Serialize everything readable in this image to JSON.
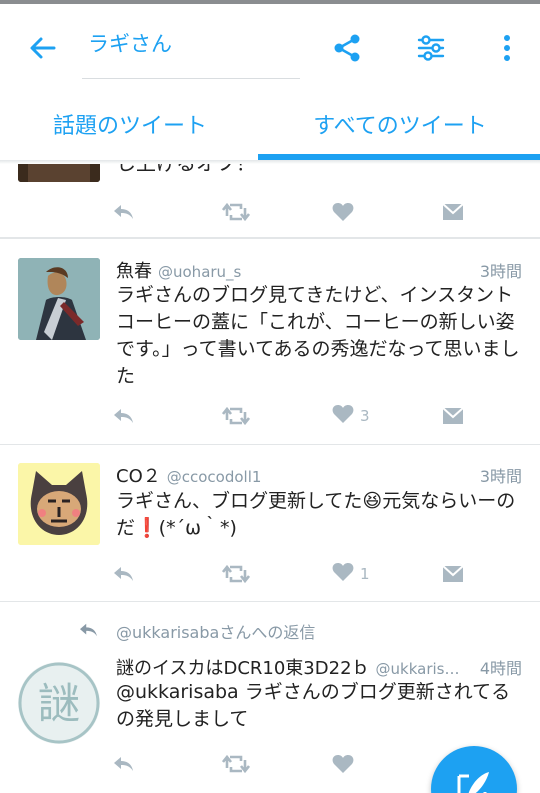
{
  "search": {
    "query": "ラギさん"
  },
  "tabs": [
    {
      "label": "話題のツイート"
    },
    {
      "label": "すべてのツイート"
    }
  ],
  "tweets": [
    {
      "text": "し上げるオフ？",
      "likes": ""
    },
    {
      "name": "魚春",
      "handle": "@uoharu_s",
      "time": "3時間",
      "text": "ラギさんのブログ見てきたけど、インスタントコーヒーの蓋に「これが、コーヒーの新しい姿です。」って書いてあるの秀逸だなって思いました",
      "likes": "3"
    },
    {
      "name": "CO２",
      "handle": "@ccocodoll1",
      "time": "3時間",
      "text": "ラギさん、ブログ更新してた😆元気ならいーのだ❗(*´ω｀*)",
      "likes": "1"
    },
    {
      "reply_to": "@ukkarisabaさんへの返信",
      "name": "謎のイスカはDCR10東3D22ｂ",
      "handle": "@ukkaris…",
      "time": "4時間",
      "text": "@ukkarisaba ラギさんのブログ更新されてるの発見しまして",
      "likes": ""
    }
  ],
  "colors": {
    "accent": "#1da1f2",
    "icon_gray": "#aab8c2",
    "meta_gray": "#8899a6"
  }
}
